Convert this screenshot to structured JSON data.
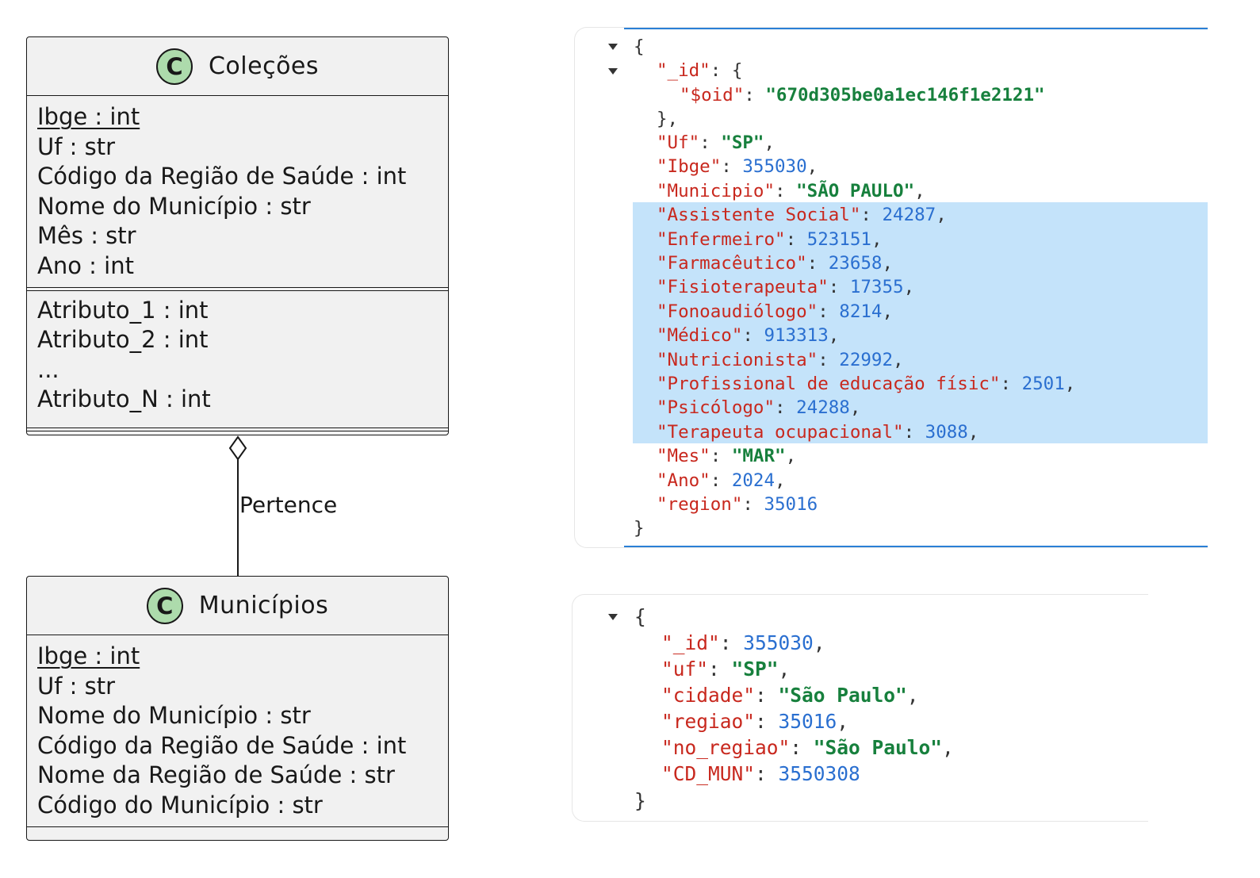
{
  "uml": {
    "colecoes": {
      "badge": "C",
      "name": "Coleções",
      "key_attr": "Ibge : int",
      "attrs": [
        "Uf : str",
        "Código da Região de Saúde : int",
        "Nome do Município : str",
        "Mês : str",
        "Ano : int"
      ],
      "extra_attrs": [
        "Atributo_1 : int",
        "Atributo_2 : int",
        "...",
        "Atributo_N : int"
      ]
    },
    "municipios": {
      "badge": "C",
      "name": "Municípios",
      "key_attr": "Ibge : int",
      "attrs": [
        "Uf : str",
        "Nome do Município : str",
        "Código da Região de Saúde : int",
        "Nome da Região de Saúde : str",
        "Código do Município : str"
      ]
    },
    "relation_label": "Pertence"
  },
  "json_colecoes": {
    "oid_key": "\"$oid\"",
    "oid_value": "\"670d305be0a1ec146f1e2121\"",
    "fields": [
      {
        "key": "\"Uf\"",
        "value": "\"SP\"",
        "type": "s"
      },
      {
        "key": "\"Ibge\"",
        "value": "355030",
        "type": "n"
      },
      {
        "key": "\"Municipio\"",
        "value": "\"SÃO PAULO\"",
        "type": "s"
      },
      {
        "key": "\"Assistente Social\"",
        "value": "24287",
        "type": "n"
      },
      {
        "key": "\"Enfermeiro\"",
        "value": "523151",
        "type": "n"
      },
      {
        "key": "\"Farmacêutico\"",
        "value": "23658",
        "type": "n"
      },
      {
        "key": "\"Fisioterapeuta\"",
        "value": "17355",
        "type": "n"
      },
      {
        "key": "\"Fonoaudiólogo\"",
        "value": "8214",
        "type": "n"
      },
      {
        "key": "\"Médico\"",
        "value": "913313",
        "type": "n"
      },
      {
        "key": "\"Nutricionista\"",
        "value": "22992",
        "type": "n"
      },
      {
        "key": "\"Profissional de educação físic\"",
        "value": "2501",
        "type": "n"
      },
      {
        "key": "\"Psicólogo\"",
        "value": "24288",
        "type": "n"
      },
      {
        "key": "\"Terapeuta ocupacional\"",
        "value": "3088",
        "type": "n"
      },
      {
        "key": "\"Mes\"",
        "value": "\"MAR\"",
        "type": "s"
      },
      {
        "key": "\"Ano\"",
        "value": "2024",
        "type": "n"
      },
      {
        "key": "\"region\"",
        "value": "35016",
        "type": "n"
      }
    ]
  },
  "json_municipios": {
    "fields": [
      {
        "key": "\"_id\"",
        "value": "355030",
        "type": "n"
      },
      {
        "key": "\"uf\"",
        "value": "\"SP\"",
        "type": "s"
      },
      {
        "key": "\"cidade\"",
        "value": "\"São Paulo\"",
        "type": "s"
      },
      {
        "key": "\"regiao\"",
        "value": "35016",
        "type": "n"
      },
      {
        "key": "\"no_regiao\"",
        "value": "\"São Paulo\"",
        "type": "s"
      },
      {
        "key": "\"CD_MUN\"",
        "value": "3550308",
        "type": "n"
      }
    ]
  },
  "colors": {
    "json_key": "#c8281e",
    "json_string": "#17803d",
    "json_number": "#2a6fd0",
    "highlight": "#c4e3fa",
    "uml_badge": "#addbac"
  }
}
